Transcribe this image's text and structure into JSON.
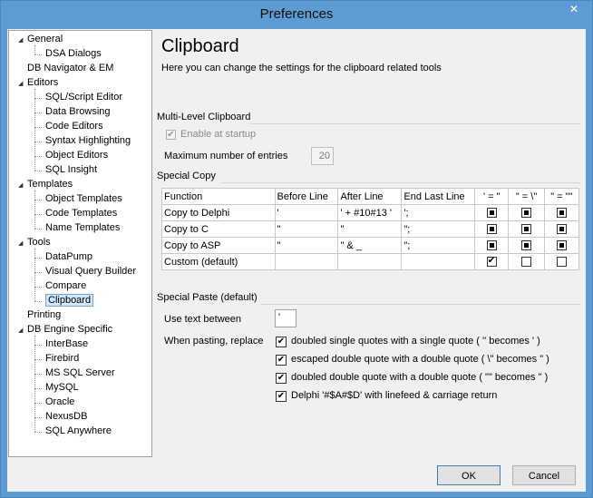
{
  "window": {
    "title": "Preferences",
    "close_symbol": "✕"
  },
  "tree": {
    "items": [
      {
        "label": "General",
        "level": 0,
        "expander": "◢"
      },
      {
        "label": "DSA Dialogs",
        "level": 1
      },
      {
        "label": "DB Navigator & EM",
        "level": 0
      },
      {
        "label": "Editors",
        "level": 0,
        "expander": "◢"
      },
      {
        "label": "SQL/Script Editor",
        "level": 1
      },
      {
        "label": "Data Browsing",
        "level": 1
      },
      {
        "label": "Code Editors",
        "level": 1
      },
      {
        "label": "Syntax Highlighting",
        "level": 1
      },
      {
        "label": "Object Editors",
        "level": 1
      },
      {
        "label": "SQL Insight",
        "level": 1
      },
      {
        "label": "Templates",
        "level": 0,
        "expander": "◢"
      },
      {
        "label": "Object Templates",
        "level": 1
      },
      {
        "label": "Code Templates",
        "level": 1
      },
      {
        "label": "Name Templates",
        "level": 1
      },
      {
        "label": "Tools",
        "level": 0,
        "expander": "◢"
      },
      {
        "label": "DataPump",
        "level": 1
      },
      {
        "label": "Visual Query Builder",
        "level": 1
      },
      {
        "label": "Compare",
        "level": 1
      },
      {
        "label": "Clipboard",
        "level": 1,
        "selected": true
      },
      {
        "label": "Printing",
        "level": 0
      },
      {
        "label": "DB Engine Specific",
        "level": 0,
        "expander": "◢"
      },
      {
        "label": "InterBase",
        "level": 1
      },
      {
        "label": "Firebird",
        "level": 1
      },
      {
        "label": "MS SQL Server",
        "level": 1
      },
      {
        "label": "MySQL",
        "level": 1
      },
      {
        "label": "Oracle",
        "level": 1
      },
      {
        "label": "NexusDB",
        "level": 1
      },
      {
        "label": "SQL Anywhere",
        "level": 1
      }
    ]
  },
  "content": {
    "heading": "Clipboard",
    "description": "Here you can change the settings for the clipboard related tools",
    "multi_level": {
      "section_title": "Multi-Level Clipboard",
      "enable_label": "Enable at startup",
      "enable_checked": true,
      "max_entries_label": "Maximum number of entries",
      "max_entries_value": "20"
    },
    "special_copy": {
      "section_title": "Special Copy",
      "columns": [
        "Function",
        "Before Line",
        "After Line",
        "End Last Line",
        "' = \"",
        "\" = \\\"",
        "\" = \"\""
      ],
      "rows": [
        {
          "function": "Copy to Delphi",
          "before": "'",
          "after": "' + #10#13 '",
          "end": "';",
          "flags": [
            "filled",
            "filled",
            "filled"
          ]
        },
        {
          "function": "Copy to C",
          "before": "\"",
          "after": "\"",
          "end": "\";",
          "flags": [
            "filled",
            "filled",
            "filled"
          ]
        },
        {
          "function": "Copy to ASP",
          "before": "\"",
          "after": "\" & _",
          "end": "\";",
          "flags": [
            "filled",
            "filled",
            "filled"
          ]
        },
        {
          "function": "Custom (default)",
          "before": "",
          "after": "",
          "end": "",
          "flags": [
            "checked",
            "empty",
            "empty"
          ]
        }
      ]
    },
    "special_paste": {
      "section_title": "Special Paste (default)",
      "use_text_between_label": "Use text between",
      "use_text_between_value": "'",
      "when_pasting_label": "When pasting, replace",
      "options": [
        {
          "label": "doubled single quotes with a single quote ( '' becomes ' )",
          "checked": true
        },
        {
          "label": "escaped double quote with a double quote ( \\\" becomes \" )",
          "checked": true
        },
        {
          "label": "doubled double quote with a double quote ( \"\" becomes \" )",
          "checked": true
        },
        {
          "label": "Delphi '#$A#$D' with linefeed & carriage return",
          "checked": true
        }
      ]
    }
  },
  "buttons": {
    "ok": "OK",
    "cancel": "Cancel"
  },
  "colors": {
    "titlebar": "#5c9bd3",
    "client": "#f0f0f0",
    "selection": "#cce8ff"
  }
}
